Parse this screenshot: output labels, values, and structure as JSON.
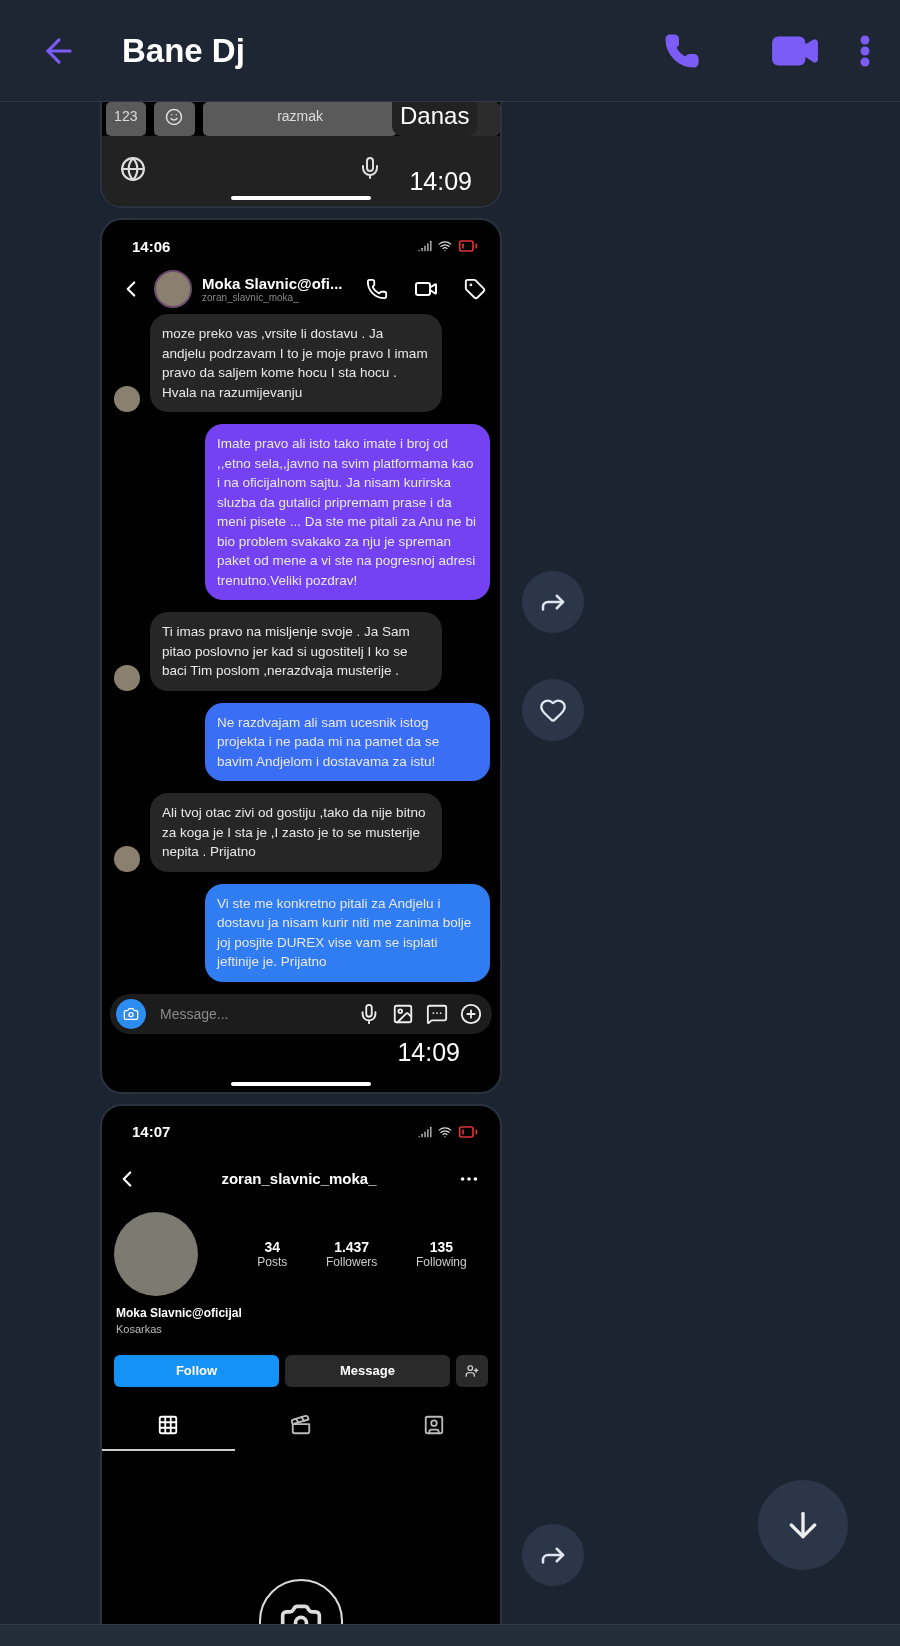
{
  "header": {
    "title": "Bane Dj"
  },
  "date_label": "Danas",
  "screens": [
    {
      "kind": "keyboard",
      "keys": [
        "123",
        "razmak"
      ],
      "time": "14:09"
    },
    {
      "kind": "dm",
      "status_time": "14:06",
      "contact": {
        "name": "Moka Slavnic@ofi...",
        "username": "zoran_slavnic_moka_"
      },
      "chat": [
        {
          "kind": "received",
          "text": "moze preko vas ,vrsite li dostavu . Ja andjelu podrzavam I to je moje pravo I imam pravo da saljem kome hocu I sta hocu . Hvala na razumijevanju"
        },
        {
          "kind": "sent",
          "color": "#7442f2",
          "text": "Imate pravo ali isto tako imate i broj od ,,etno sela,,javno na svim platformama kao i na oficijalnom sajtu. Ja nisam kurirska sluzba  da gutalici pripremam prase i da meni pisete ... Da ste me pitali za Anu ne bi bio problem svakako za nju je spreman paket od mene a vi ste na pogresnoj adresi trenutno.Veliki pozdrav!"
        },
        {
          "kind": "received",
          "text": "Ti imas pravo na misljenje svoje . Ja Sam pitao poslovno jer kad si ugostitelj I ko se baci Tim poslom ,nerazdvaja musterije ."
        },
        {
          "kind": "sent",
          "color": "#3a6ef5",
          "text": "Ne razdvajam ali sam ucesnik istog projekta i ne pada mi na pamet da se bavim Andjelom i dostavama za istu!"
        },
        {
          "kind": "received",
          "text": "Ali tvoj otac zivi od gostiju ,tako da nije bitno za koga je I sta je ,I zasto je to se musterije nepita . Prijatno"
        },
        {
          "kind": "sent",
          "color": "#2f7cf3",
          "text": "Vi ste me konkretno pitali za Andjelu i dostavu ja nisam kurir niti me zanima bolje joj posjite DUREX vise vam se isplati jeftinije je. Prijatno"
        }
      ],
      "input_placeholder": "Message...",
      "time": "14:09"
    },
    {
      "kind": "profile",
      "status_time": "14:07",
      "username": "zoran_slavnic_moka_",
      "stats": [
        {
          "value": "34",
          "label": "Posts"
        },
        {
          "value": "1.437",
          "label": "Followers"
        },
        {
          "value": "135",
          "label": "Following"
        }
      ],
      "name": "Moka Slavnic@oficijal",
      "bio": "Kosarkas",
      "buttons": [
        {
          "kind": "primary",
          "label": "Follow"
        },
        {
          "kind": "secondary",
          "label": "Message"
        }
      ],
      "tabs": [
        {
          "kind": "grid",
          "selected": true
        },
        {
          "kind": "reels",
          "selected": false
        },
        {
          "kind": "tagged",
          "selected": false
        }
      ]
    }
  ]
}
